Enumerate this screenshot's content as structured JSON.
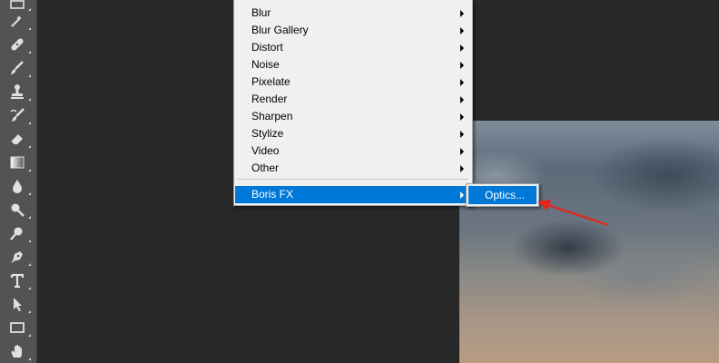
{
  "toolbar": {
    "tools": [
      {
        "name": "frame-tool-icon"
      },
      {
        "name": "spot-healing-brush-icon"
      },
      {
        "name": "bandage-icon"
      },
      {
        "name": "brush-icon"
      },
      {
        "name": "clone-stamp-icon"
      },
      {
        "name": "history-brush-icon"
      },
      {
        "name": "eraser-icon"
      },
      {
        "name": "gradient-icon"
      },
      {
        "name": "blur-drop-icon"
      },
      {
        "name": "dodge-icon"
      },
      {
        "name": "magnifier-icon"
      },
      {
        "name": "pen-icon"
      },
      {
        "name": "type-icon"
      },
      {
        "name": "path-selection-icon"
      },
      {
        "name": "rectangle-icon"
      },
      {
        "name": "hand-icon"
      }
    ]
  },
  "filter_menu": {
    "items": [
      {
        "label": "Blur",
        "has_submenu": true
      },
      {
        "label": "Blur Gallery",
        "has_submenu": true
      },
      {
        "label": "Distort",
        "has_submenu": true
      },
      {
        "label": "Noise",
        "has_submenu": true
      },
      {
        "label": "Pixelate",
        "has_submenu": true
      },
      {
        "label": "Render",
        "has_submenu": true
      },
      {
        "label": "Sharpen",
        "has_submenu": true
      },
      {
        "label": "Stylize",
        "has_submenu": true
      },
      {
        "label": "Video",
        "has_submenu": true
      },
      {
        "label": "Other",
        "has_submenu": true
      }
    ],
    "selected_item": {
      "label": "Boris FX",
      "has_submenu": true
    }
  },
  "submenu": {
    "item": {
      "label": "Optics..."
    }
  },
  "colors": {
    "menu_background": "#f0f0f0",
    "highlight": "#0078d7",
    "annotation_arrow": "#e8231c",
    "toolbar_background": "#535353",
    "workspace_background": "#282828"
  }
}
